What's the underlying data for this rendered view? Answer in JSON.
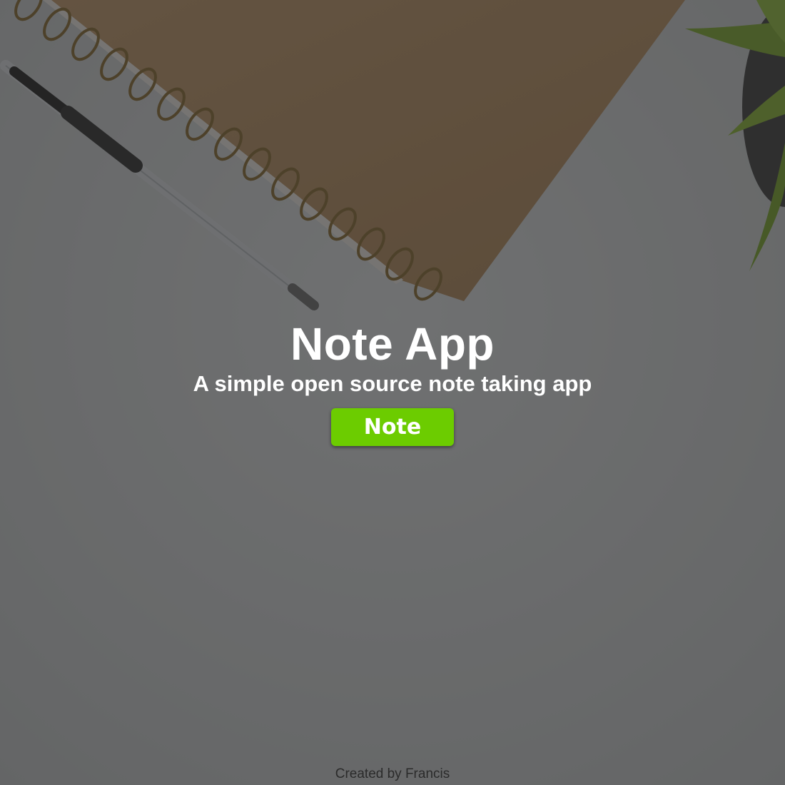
{
  "hero": {
    "title": "Note App",
    "subtitle": "A simple open source note taking app",
    "button_label": "Note"
  },
  "footer": {
    "credit": "Created by Francis"
  },
  "colors": {
    "button_bg": "#6ccc00",
    "text_primary": "#ffffff",
    "footer_text": "#2b2b2b",
    "overlay": "rgba(40,40,40,0.62)"
  },
  "icons": {
    "background": "desk-photo-notebook-pen-plant"
  }
}
